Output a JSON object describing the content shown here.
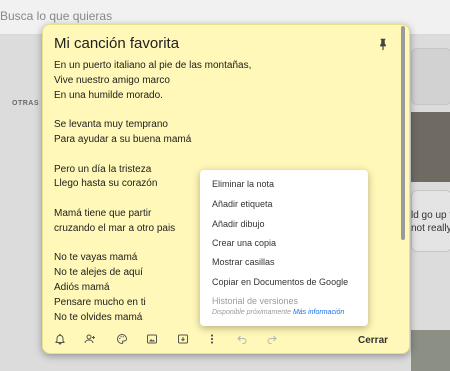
{
  "search": {
    "placeholder": "Busca lo que quieras"
  },
  "section_label": "OTRAS",
  "bg_note": {
    "line1": "ld go up to",
    "line2": "not really"
  },
  "note": {
    "title": "Mi canción favorita",
    "lines": [
      "En un puerto italiano al pie de las montañas,",
      "Vive nuestro amigo marco",
      "En una humilde morado.",
      "",
      "Se levanta muy temprano",
      "Para ayudar a su buena mamá",
      "",
      "Pero un día la tristeza",
      "Llego hasta su corazón",
      "",
      "Mamá tiene que partir",
      "cruzando el mar a otro pais",
      "",
      "No te vayas mamá",
      "No te alejes de aquí",
      "Adiós mamá",
      "Pensare mucho en ti",
      "No te olvides mamá"
    ],
    "close_label": "Cerrar",
    "background_color": "#fff8b8"
  },
  "toolbar_icons": [
    "bell-plus-icon",
    "person-add-icon",
    "palette-icon",
    "image-icon",
    "archive-icon",
    "more-vert-icon",
    "undo-icon",
    "redo-icon"
  ],
  "menu": {
    "items": [
      "Eliminar la nota",
      "Añadir etiqueta",
      "Añadir dibujo",
      "Crear una copia",
      "Mostrar casillas",
      "Copiar en Documentos de Google"
    ],
    "history_label": "Historial de versiones",
    "history_sub": "Disponible próximamente",
    "history_link": "Más información"
  }
}
